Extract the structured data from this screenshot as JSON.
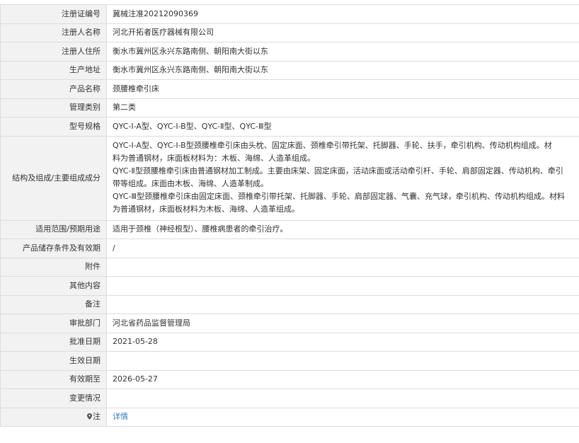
{
  "rows": [
    {
      "label": "注册证编号",
      "value": "冀械注准20212090369"
    },
    {
      "label": "注册人名称",
      "value": "河北开拓者医疗器械有限公司"
    },
    {
      "label": "注册人住所",
      "value": "衡水市冀州区永兴东路南侧、朝阳南大街以东"
    },
    {
      "label": "生产地址",
      "value": "衡水市冀州区永兴东路南侧、朝阳南大街以东"
    },
    {
      "label": "产品名称",
      "value": "颈腰椎牵引床"
    },
    {
      "label": "管理类别",
      "value": "第二类"
    },
    {
      "label": "型号规格",
      "value": "QYC-Ⅰ-A型、QYC-Ⅰ-B型、QYC-Ⅱ型、QYC-Ⅲ型"
    },
    {
      "label": "结构及组成/主要组成成分",
      "lines": [
        "QYC-Ⅰ-A型、QYC-Ⅰ-B型颈腰椎牵引床由头枕、固定床面、颈椎牵引带托架、托脚器、手轮、扶手，牵引机构、传动机构组成。材",
        "料为普通钢材，床面板材料为：木板、海绵、人造革组成。",
        "QYC-Ⅱ型颈腰椎牵引床由普通钢材加工制成。主要由床架、固定床面，活动床面或活动牵引杆、手轮、肩部固定器、传动机构、牵引",
        "带等组成。床面由木板、海绵、人造革制成。",
        "QYC-Ⅲ型颈腰椎牵引床由固定床面、颈椎牵引带托架、托脚器、手轮、肩部固定器、气囊、充气球，牵引机构、传动机构组成。材料",
        "为普通钢材，床面板材料为木板、海绵、人造革组成。"
      ]
    },
    {
      "label": "适用范围/预期用途",
      "value": "适用于颈椎（神经根型）、腰椎病患者的牵引治疗。"
    },
    {
      "label": "产品储存条件及有效期",
      "value": "/"
    },
    {
      "label": "附件",
      "value": ""
    },
    {
      "label": "其他内容",
      "value": ""
    },
    {
      "label": "备注",
      "value": ""
    },
    {
      "label": "审批部门",
      "value": "河北省药品监督管理局"
    },
    {
      "label": "批准日期",
      "value": "2021-05-28"
    },
    {
      "label": "生效日期",
      "value": ""
    },
    {
      "label": "有效期至",
      "value": "2026-05-27"
    },
    {
      "label": "变更情况",
      "value": ""
    }
  ],
  "note": {
    "label": "注",
    "link_text": "详情",
    "icon": "location-pin-icon",
    "link_color": "#2a7fc9"
  }
}
